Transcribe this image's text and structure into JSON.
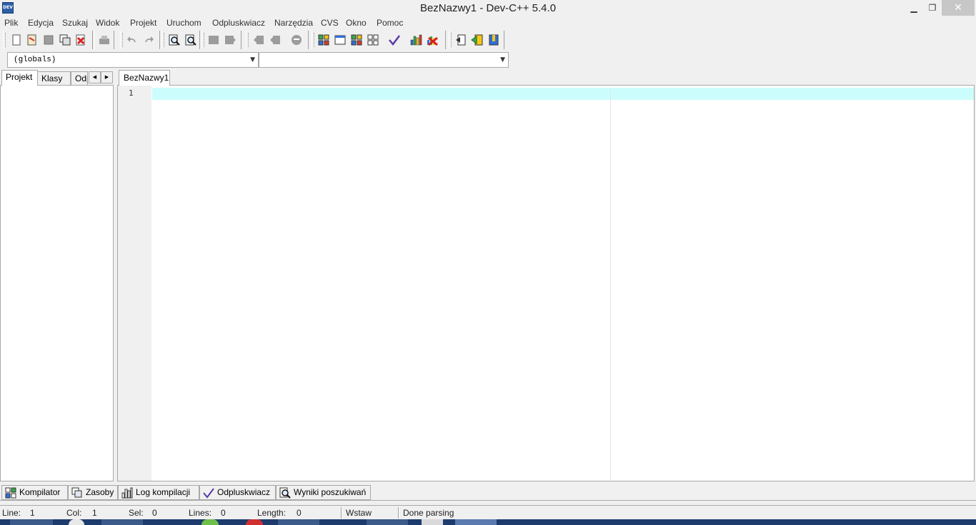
{
  "window": {
    "title": "BezNazwy1 - Dev-C++ 5.4.0",
    "app_icon_text": "DEV",
    "minimize_glyph": "▁",
    "maximize_glyph": "❐",
    "close_glyph": "✕"
  },
  "menu": [
    "Plik",
    "Edycja",
    "Szukaj",
    "Widok",
    "Projekt",
    "Uruchom",
    "Odpluskwiacz",
    "Narzędzia",
    "CVS",
    "Okno",
    "Pomoc"
  ],
  "toolbar": {
    "icons": [
      "new-file-icon",
      "open-file-icon",
      "save-icon",
      "save-all-icon",
      "close-file-icon",
      "print-icon",
      "undo-icon",
      "redo-icon",
      "find-icon",
      "replace-icon",
      "indent-icon",
      "unindent-icon",
      "bookmark-back-icon",
      "bookmark-forward-icon",
      "goto-line-icon",
      "compile-icon",
      "run-icon",
      "compile-run-icon",
      "rebuild-icon",
      "syntax-check-icon",
      "profile-icon",
      "delete-profile-icon",
      "new-project-icon",
      "add-to-project-icon",
      "remove-from-project-icon"
    ]
  },
  "combos": {
    "scope_value": "(globals)",
    "member_value": ""
  },
  "left_panel": {
    "tabs": [
      "Projekt",
      "Klasy",
      "Odpluskwiacz"
    ],
    "scroll_left": "◀",
    "scroll_right": "▶"
  },
  "editor": {
    "tab_label": "BezNazwy1",
    "line_number": "1",
    "active_line_color": "#ccfdfd"
  },
  "bottom_tabs": [
    {
      "label": "Kompilator",
      "icon": "compiler-grid-icon"
    },
    {
      "label": "Zasoby",
      "icon": "resources-icon"
    },
    {
      "label": "Log kompilacji",
      "icon": "compile-log-chart-icon"
    },
    {
      "label": "Odpluskwiacz",
      "icon": "debug-checkmark-icon"
    },
    {
      "label": "Wyniki poszukiwań",
      "icon": "search-results-icon"
    }
  ],
  "status": {
    "line_label": "Line:",
    "line_value": "1",
    "col_label": "Col:",
    "col_value": "1",
    "sel_label": "Sel:",
    "sel_value": "0",
    "lines_label": "Lines:",
    "lines_value": "0",
    "length_label": "Length:",
    "length_value": "0",
    "mode": "Wstaw",
    "message": "Done parsing"
  }
}
